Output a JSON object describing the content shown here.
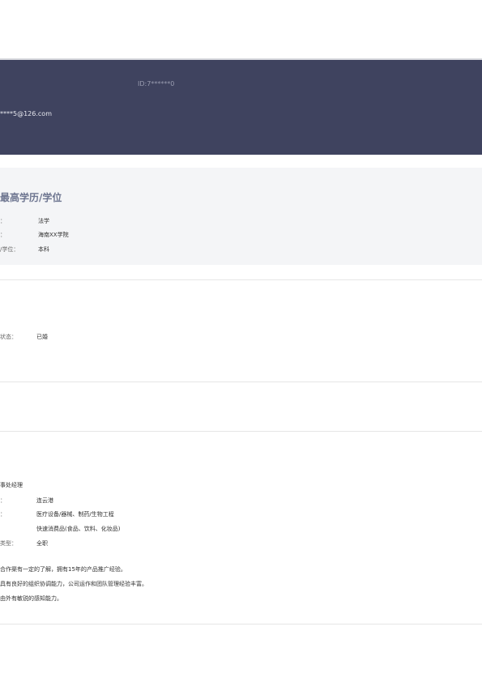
{
  "profile": {
    "id": "ID:7******0",
    "email": "****5@126.com"
  },
  "education": {
    "title": "最高学历/学位",
    "rows": [
      {
        "label": "：",
        "value": "法学"
      },
      {
        "label": "：",
        "value": "海南XX学院"
      },
      {
        "label": "/学位：",
        "value": "本科"
      }
    ]
  },
  "personal": {
    "rows": [
      {
        "label": "状态：",
        "value": "已婚"
      }
    ]
  },
  "intention": {
    "heading_partial": "事处经理",
    "rows": [
      {
        "label": "：",
        "value": "连云港"
      },
      {
        "label": "：",
        "value": "医疗设备/器械、制药/生物工程"
      },
      {
        "label": "",
        "value": "快速消费品(食品、饮料、化妆品)"
      },
      {
        "label": "类型：",
        "value": "全职"
      }
    ],
    "description": [
      "合作渠有一定的了解，拥有15年的产品推广经验。",
      "具有良好的组织协调能力，公司运作和团队管理经验丰富。",
      "由外有敏锐的感知能力。"
    ]
  }
}
